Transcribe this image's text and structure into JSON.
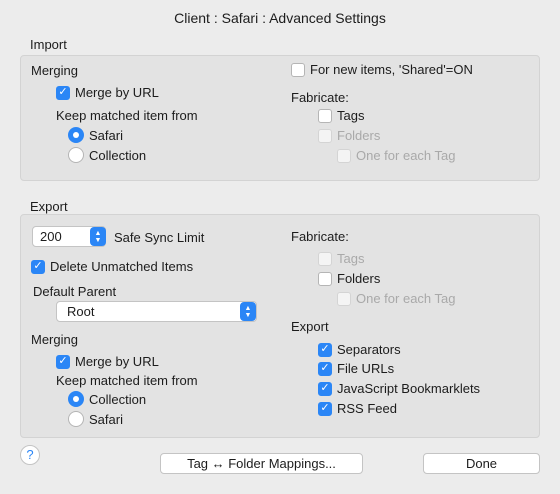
{
  "window": {
    "title": "Client : Safari : Advanced Settings"
  },
  "import": {
    "section_label": "Import",
    "merging_label": "Merging",
    "merge_by_url": {
      "label": "Merge by URL",
      "checked": true
    },
    "keep_matched_label": "Keep matched item from",
    "keep_options": [
      {
        "label": "Safari",
        "selected": true
      },
      {
        "label": "Collection",
        "selected": false
      }
    ],
    "shared_on": {
      "label": "For new items, 'Shared'=ON",
      "checked": false
    },
    "fabricate_label": "Fabricate:",
    "fabricate": {
      "tags": {
        "label": "Tags",
        "checked": false,
        "enabled": true
      },
      "folders": {
        "label": "Folders",
        "checked": false,
        "enabled": false
      },
      "one_each_tag": {
        "label": "One for each Tag",
        "checked": false,
        "enabled": false
      }
    }
  },
  "export": {
    "section_label": "Export",
    "safe_sync_value": "200",
    "safe_sync_label": "Safe Sync Limit",
    "delete_unmatched": {
      "label": "Delete Unmatched Items",
      "checked": true
    },
    "default_parent_label": "Default Parent",
    "default_parent_value": "Root",
    "merging_label": "Merging",
    "merge_by_url": {
      "label": "Merge by URL",
      "checked": true
    },
    "keep_matched_label": "Keep matched item from",
    "keep_options": [
      {
        "label": "Collection",
        "selected": true
      },
      {
        "label": "Safari",
        "selected": false
      }
    ],
    "fabricate_label": "Fabricate:",
    "fabricate": {
      "tags": {
        "label": "Tags",
        "checked": false,
        "enabled": false
      },
      "folders": {
        "label": "Folders",
        "checked": false,
        "enabled": true
      },
      "one_each_tag": {
        "label": "One for each Tag",
        "checked": false,
        "enabled": false
      }
    },
    "export_label": "Export",
    "export_items": [
      {
        "label": "Separators",
        "checked": true
      },
      {
        "label": "File URLs",
        "checked": true
      },
      {
        "label": "JavaScript Bookmarklets",
        "checked": true
      },
      {
        "label": "RSS Feed",
        "checked": true
      }
    ]
  },
  "footer": {
    "help_label": "?",
    "mappings_button": "Tag ↔ Folder Mappings...",
    "done_button": "Done"
  },
  "colors": {
    "accent": "#2b86f6",
    "background": "#ececec",
    "panel": "#e3e3e3"
  }
}
